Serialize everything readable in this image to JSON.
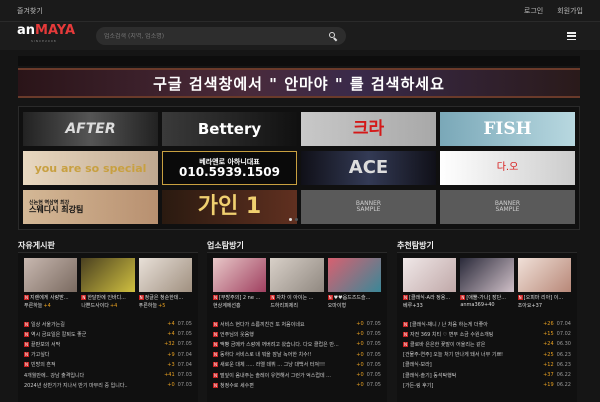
{
  "topbar": {
    "favorite": "즐겨찾기",
    "login": "로그인",
    "signup": "회원가입"
  },
  "header": {
    "logo_an": "an",
    "logo_maya": "MAYA",
    "logo_sub": "SINCE2008",
    "search_placeholder": "업소검색 (지역, 업소명)"
  },
  "banner": {
    "text": "구글 검색창에서 \" 안마야 \" 를 검색하세요"
  },
  "tiles": [
    {
      "label": "AFTER"
    },
    {
      "label": "Bettery"
    },
    {
      "label": "크라"
    },
    {
      "label": "FISH"
    },
    {
      "label": "you are so special"
    },
    {
      "label_a": "베라앤로 아하니대표",
      "label_b": "010.5939.1509"
    },
    {
      "label": "ACE"
    },
    {
      "label": "다.오"
    },
    {
      "label_a": "신논현 역삼역 최강",
      "label_b": "스웨디시 최강팀"
    },
    {
      "label": "가인 1"
    },
    {
      "label_a": "BANNER",
      "label_b": "SAMPLE"
    },
    {
      "label_a": "BANNER",
      "label_b": "SAMPLE"
    }
  ],
  "columns": [
    {
      "title": "자유게시판",
      "thumbs": [
        {
          "caption": "지렌에게 사랑받...",
          "count": "+4",
          "sub": "푸른하늘"
        },
        {
          "caption": "한달만에 인바디...",
          "count": "+4",
          "sub": "나쁜드사이다"
        },
        {
          "caption": "정글은 청순한데...",
          "count": "+5",
          "sub": "푸른하늘"
        }
      ],
      "rows": [
        {
          "title": "일상 서울가는길",
          "num": "+4",
          "date": "07.05"
        },
        {
          "title": "역시 금요일은 칼퇴도 좋군",
          "num": "+4",
          "date": "07.05"
        },
        {
          "title": "끝판보의 서막",
          "num": "+32",
          "date": "07.05"
        },
        {
          "title": "가고싶다",
          "num": "+9",
          "date": "07.04"
        },
        {
          "title": "빈방의 흔적",
          "num": "+3",
          "date": "07.04"
        },
        {
          "title": "4개월만에.. 강남 출격입니다",
          "num": "+41",
          "date": "07.03"
        },
        {
          "title": "2024년 상반기가 지나서 반기 마무리 중 입니다..",
          "num": "+0",
          "date": "07.03"
        }
      ]
    },
    {
      "title": "업소탐방기",
      "thumbs": [
        {
          "caption": "[부방주의] 2 ne ...",
          "count": "",
          "sub": "현상계에선흥"
        },
        {
          "caption": "자차 이 아이는 ...",
          "count": "",
          "sub": "드하리피제리"
        },
        {
          "caption": "♥♥옵드즈드슬...",
          "count": "",
          "sub": "오마이형"
        }
      ],
      "rows": [
        {
          "title": "서비스 현다가 소름끼친건 또 처음이네요",
          "num": "+0",
          "date": "07.05"
        },
        {
          "title": "언주님의 웃음행",
          "num": "+0",
          "date": "07.05"
        },
        {
          "title": "맥빵 금메카 스랑에 꺼버려고 왔습니다. 다오 클럽은 만...",
          "num": "+0",
          "date": "07.05"
        },
        {
          "title": "동하다 서비스로 내 뭐을 잠날 녹어한 치수!!",
          "num": "+0",
          "date": "07.05"
        },
        {
          "title": "새로운 대체 ..... 라엘 데뷔 ... 그냥 대백서 터져!!!",
          "num": "+0",
          "date": "07.05"
        },
        {
          "title": "떨잎이 옴내주는 솔레이 유연해서 그런가 억스럽데 ...",
          "num": "+0",
          "date": "07.05"
        },
        {
          "title": "청정수로 세수편",
          "num": "+0",
          "date": "07.05"
        }
      ]
    },
    {
      "title": "추천탐방기",
      "thumbs": [
        {
          "caption": "[클래식-A라 정용...",
          "count": "",
          "sub": "베루+33"
        },
        {
          "caption": "[애뿔-가나] 장단...",
          "count": "",
          "sub": "anma369+40"
        },
        {
          "caption": "[오피마 리아] 이...",
          "count": "",
          "sub": "조아요+37"
        }
      ],
      "rows": [
        {
          "title": "[클래식-채니 / 난 처음 하는게 더좋아",
          "num": "+26",
          "date": "07.04"
        },
        {
          "title": "자전 369 치티 ♡ 변무 소금 수원소개팅",
          "num": "+15",
          "date": "07.02"
        },
        {
          "title": "클로바 은은한 꽃말이 어울리는 같은",
          "num": "+24",
          "date": "06.30"
        },
        {
          "title": "[건물주-연주] 오늘 처기 만나게 돼서 너무 기쁘!",
          "num": "+25",
          "date": "06.23"
        },
        {
          "title": "[클래식-보라]",
          "num": "+12",
          "date": "06.23"
        },
        {
          "title": "[클래식-솔기] 동석탁행탁",
          "num": "+37",
          "date": "06.22"
        },
        {
          "title": "[가든-링 후기]",
          "num": "+19",
          "date": "06.22"
        }
      ]
    }
  ]
}
